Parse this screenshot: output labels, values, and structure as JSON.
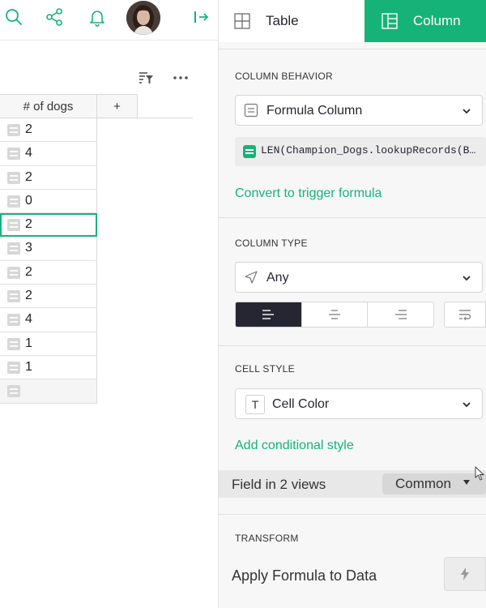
{
  "topbar": {
    "icons": [
      "search-icon",
      "share-icon",
      "bell-icon",
      "avatar",
      "exit-icon"
    ]
  },
  "grid": {
    "column_header": "# of dogs",
    "add_column_label": "+",
    "rows": [
      "2",
      "4",
      "2",
      "0",
      "2",
      "3",
      "2",
      "2",
      "4",
      "1",
      "1"
    ],
    "selected_row_index": 4
  },
  "panel": {
    "tab_table": "Table",
    "tab_column": "Column",
    "column_behavior": {
      "title": "COLUMN BEHAVIOR",
      "select_value": "Formula Column",
      "formula": "LEN(Champion_Dogs.lookupRecords(B…",
      "convert_link": "Convert to trigger formula"
    },
    "column_type": {
      "title": "COLUMN TYPE",
      "select_value": "Any"
    },
    "cell_style": {
      "title": "CELL STYLE",
      "t_glyph": "T",
      "select_value": "Cell Color",
      "add_link": "Add conditional style"
    },
    "field_views": {
      "label": "Field in 2 views",
      "button": "Common"
    },
    "transform": {
      "title": "TRANSFORM",
      "apply_label": "Apply Formula to Data"
    }
  },
  "colors": {
    "accent": "#16b378",
    "dark": "#262633"
  }
}
